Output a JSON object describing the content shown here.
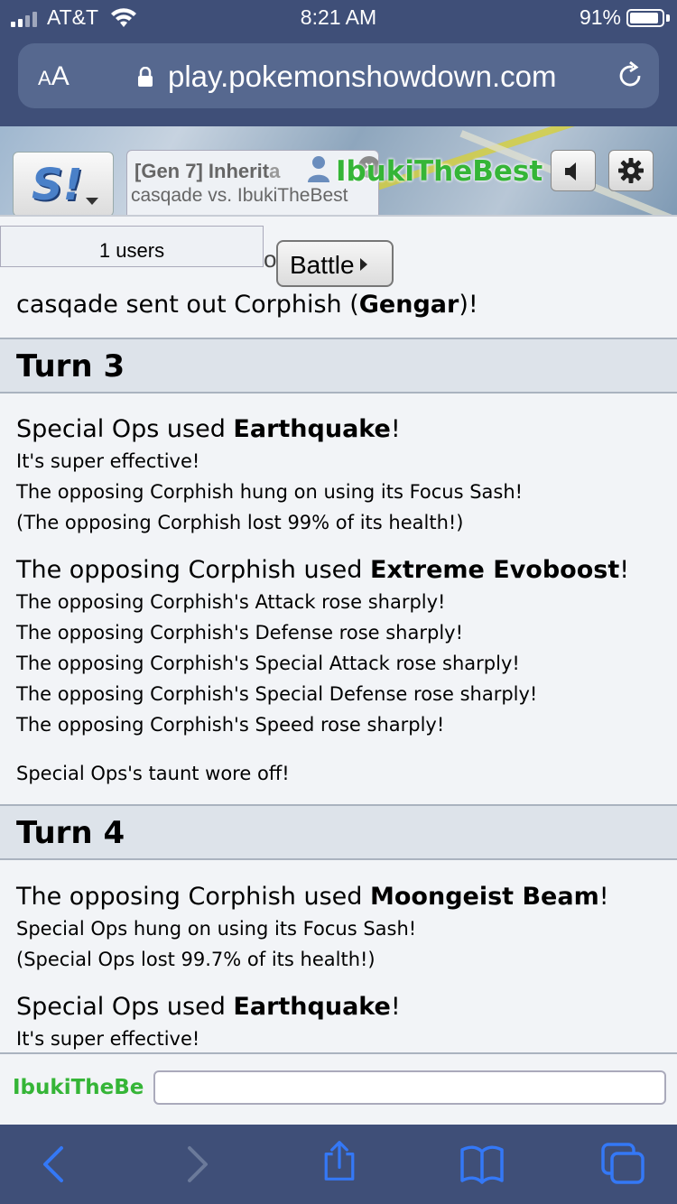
{
  "status_bar": {
    "carrier": "AT&T",
    "time": "8:21 AM",
    "battery": "91%",
    "battery_level": 0.91
  },
  "browser": {
    "text_size_label_small": "A",
    "text_size_label_large": "A",
    "url": "play.pokemonshowdown.com"
  },
  "header": {
    "room_title": "[Gen 7] Inherit",
    "room_title_fragment": "a",
    "room_subtitle": "casqade vs. IbukiTheBest",
    "close_glyph": "×",
    "username": "IbukiTheBest"
  },
  "battle": {
    "users_count": "1 users",
    "battle_button": "Battle",
    "hidden_fragment": "os",
    "log": {
      "sent_out": {
        "pre": "casqade sent out Corphish (",
        "bold": "Gengar",
        "post": ")!"
      },
      "turn3": {
        "label": "Turn 3",
        "move1": {
          "pre": "Special Ops used ",
          "bold": "Earthquake",
          "post": "!"
        },
        "move1_lines": [
          "It's super effective!",
          "The opposing Corphish hung on using its Focus Sash!",
          "(The opposing Corphish lost 99% of its health!)"
        ],
        "move2": {
          "pre": "The opposing Corphish used ",
          "bold": "Extreme Evoboost",
          "post": "!"
        },
        "move2_lines": [
          "The opposing Corphish's Attack rose sharply!",
          "The opposing Corphish's Defense rose sharply!",
          "The opposing Corphish's Special Attack rose sharply!",
          "The opposing Corphish's Special Defense rose sharply!",
          "The opposing Corphish's Speed rose sharply!"
        ],
        "end_line": "Special Ops's taunt wore off!"
      },
      "turn4": {
        "label": "Turn 4",
        "move1": {
          "pre": "The opposing Corphish used ",
          "bold": "Moongeist Beam",
          "post": "!"
        },
        "move1_lines": [
          "Special Ops hung on using its Focus Sash!",
          "(Special Ops lost 99.7% of its health!)"
        ],
        "move2": {
          "pre": "Special Ops used ",
          "bold": "Earthquake",
          "post": "!"
        },
        "move2_lines": [
          "It's super effective!"
        ]
      }
    }
  },
  "chat": {
    "name": "IbukiTheBest",
    "input_value": ""
  },
  "icons": [
    "signal-icon",
    "wifi-icon",
    "battery-icon",
    "lock-icon",
    "reload-icon",
    "showdown-logo",
    "user-icon",
    "sound-icon",
    "gear-icon",
    "back-icon",
    "forward-icon",
    "share-icon",
    "bookmarks-icon",
    "tabs-icon"
  ],
  "colors": {
    "browser_chrome": "#3f4f78",
    "username_green": "#35b537",
    "turn_header_bg": "#dde3ea",
    "ios_blue": "#3478f6"
  }
}
